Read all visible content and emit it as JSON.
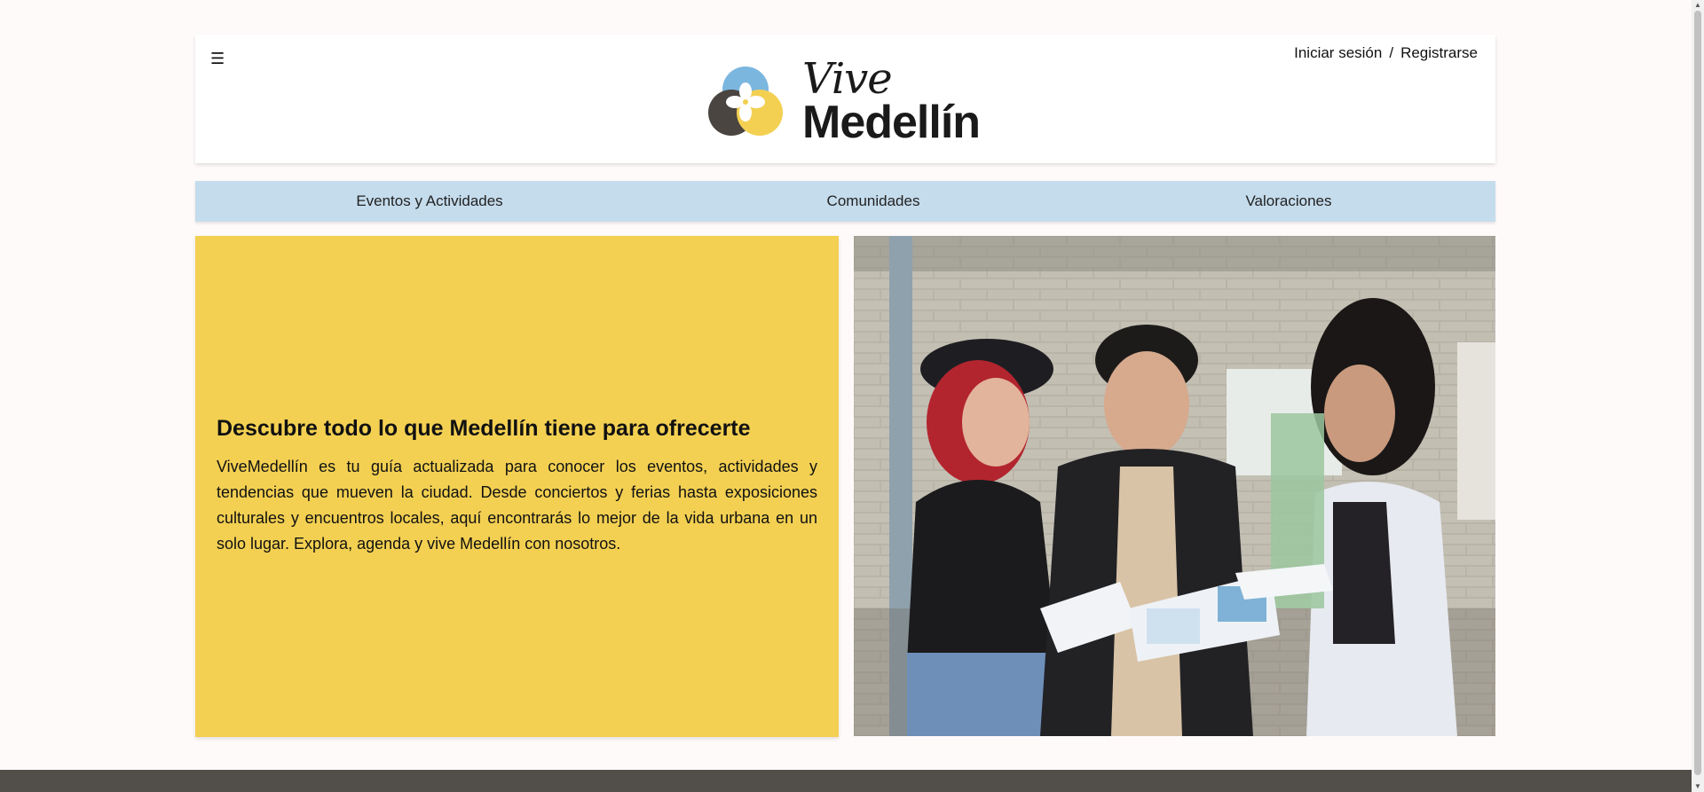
{
  "header": {
    "menu_icon": "hamburger-icon",
    "logo": {
      "line1": "Vive",
      "line2": "Medellín"
    },
    "auth": {
      "login": "Iniciar sesión",
      "separator": "/",
      "register": "Registrarse"
    }
  },
  "nav": {
    "items": [
      "Eventos y Actividades",
      "Comunidades",
      "Valoraciones"
    ]
  },
  "hero": {
    "title": "Descubre todo lo que Medellín tiene para ofrecerte",
    "body": "ViveMedellín es tu guía actualizada para conocer los eventos, actividades y tendencias que mueven la ciudad. Desde conciertos y ferias hasta exposiciones culturales y encuentros locales, aquí encontrarás lo mejor de la vida urbana en un solo lugar. Explora, agenda y vive Medellín con nosotros."
  },
  "colors": {
    "nav_bg": "#c5dced",
    "hero_yellow": "#f3d052",
    "footer": "#524e49",
    "logo_blue": "#7bb6df",
    "logo_yellow": "#f3d052",
    "logo_dark": "#4a4540"
  }
}
